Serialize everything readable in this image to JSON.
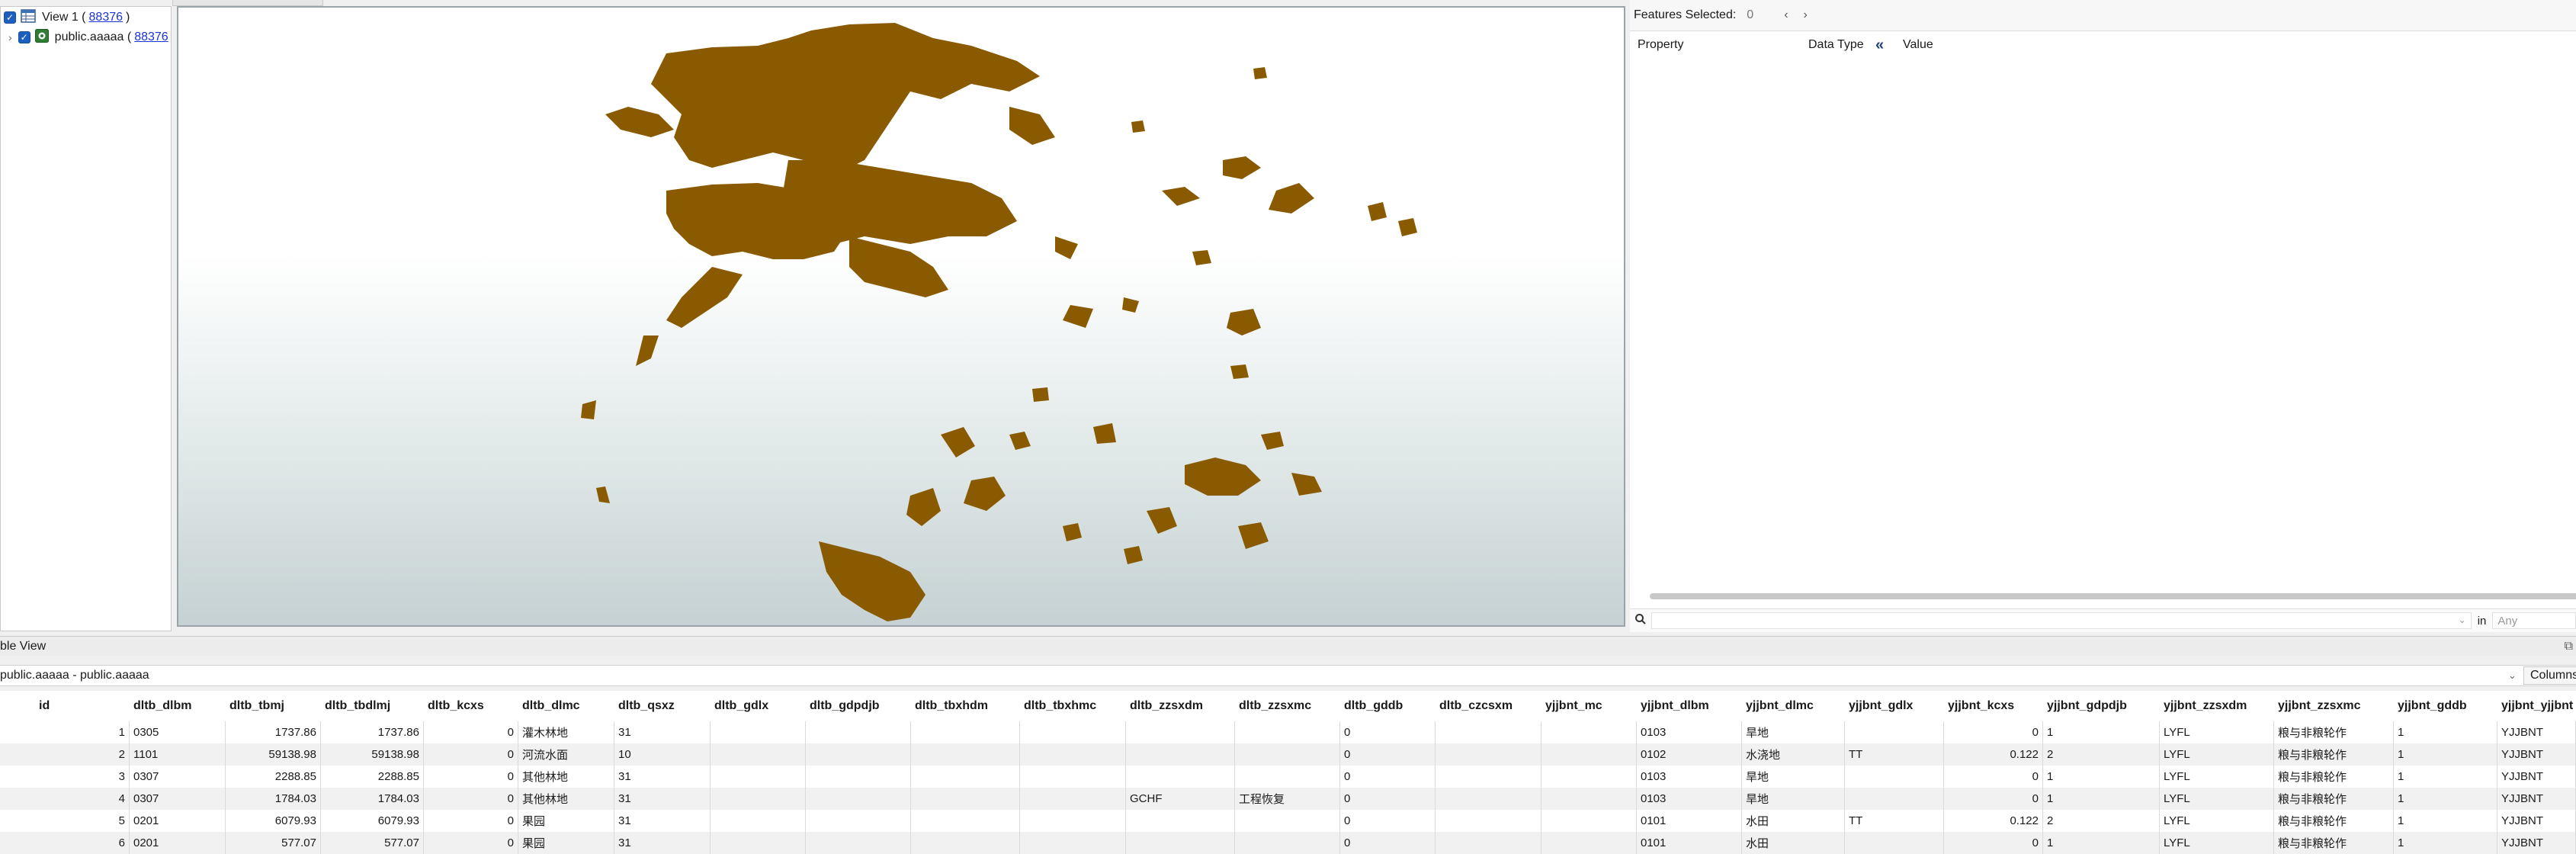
{
  "colors": {
    "map_fill": "#8a5a00",
    "link": "#1a34d8",
    "accent": "#1d5fbf"
  },
  "layer_tree": {
    "view_label": "View 1 (",
    "view_count": "88376",
    "view_suffix": ")",
    "layer_label": "public.aaaaa (",
    "layer_count": "88376"
  },
  "props": {
    "features_selected_label": "Features Selected:",
    "features_selected_count": "0",
    "col_property": "Property",
    "col_datatype": "Data Type",
    "col_value": "Value",
    "in_label": "in",
    "any_label": "Any"
  },
  "table_panel": {
    "title": "ble View",
    "layer_combo": "public.aaaaa - public.aaaaa",
    "columns_button": "Columns"
  },
  "table": {
    "headers": [
      "id",
      "dltb_dlbm",
      "dltb_tbmj",
      "dltb_tbdlmj",
      "dltb_kcxs",
      "dltb_dlmc",
      "dltb_qsxz",
      "dltb_gdlx",
      "dltb_gdpdjb",
      "dltb_tbxhdm",
      "dltb_tbxhmc",
      "dltb_zzsxdm",
      "dltb_zzsxmc",
      "dltb_gddb",
      "dltb_czcsxm",
      "yjjbnt_mc",
      "yjjbnt_dlbm",
      "yjjbnt_dlmc",
      "yjjbnt_gdlx",
      "yjjbnt_kcxs",
      "yjjbnt_gdpdjb",
      "yjjbnt_zzsxdm",
      "yjjbnt_zzsxmc",
      "yjjbnt_gddb",
      "yjjbnt_yjjbnt"
    ],
    "rows": [
      [
        "1",
        "0305",
        "1737.86",
        "1737.86",
        "0",
        "灌木林地",
        "31",
        "",
        "",
        "",
        "",
        "",
        "",
        "0",
        "",
        "",
        "0103",
        "旱地",
        "",
        "0",
        "1",
        "LYFL",
        "粮与非粮轮作",
        "1",
        "YJJBNT"
      ],
      [
        "2",
        "1101",
        "59138.98",
        "59138.98",
        "0",
        "河流水面",
        "10",
        "",
        "",
        "",
        "",
        "",
        "",
        "0",
        "",
        "",
        "0102",
        "水浇地",
        "TT",
        "0.122",
        "2",
        "LYFL",
        "粮与非粮轮作",
        "1",
        "YJJBNT"
      ],
      [
        "3",
        "0307",
        "2288.85",
        "2288.85",
        "0",
        "其他林地",
        "31",
        "",
        "",
        "",
        "",
        "",
        "",
        "0",
        "",
        "",
        "0103",
        "旱地",
        "",
        "0",
        "1",
        "LYFL",
        "粮与非粮轮作",
        "1",
        "YJJBNT"
      ],
      [
        "4",
        "0307",
        "1784.03",
        "1784.03",
        "0",
        "其他林地",
        "31",
        "",
        "",
        "",
        "",
        "GCHF",
        "工程恢复",
        "0",
        "",
        "",
        "0103",
        "旱地",
        "",
        "0",
        "1",
        "LYFL",
        "粮与非粮轮作",
        "1",
        "YJJBNT"
      ],
      [
        "5",
        "0201",
        "6079.93",
        "6079.93",
        "0",
        "果园",
        "31",
        "",
        "",
        "",
        "",
        "",
        "",
        "0",
        "",
        "",
        "0101",
        "水田",
        "TT",
        "0.122",
        "2",
        "LYFL",
        "粮与非粮轮作",
        "1",
        "YJJBNT"
      ],
      [
        "6",
        "0201",
        "577.07",
        "577.07",
        "0",
        "果园",
        "31",
        "",
        "",
        "",
        "",
        "",
        "",
        "0",
        "",
        "",
        "0101",
        "水田",
        "",
        "0",
        "1",
        "LYFL",
        "粮与非粮轮作",
        "1",
        "YJJBNT"
      ]
    ]
  }
}
